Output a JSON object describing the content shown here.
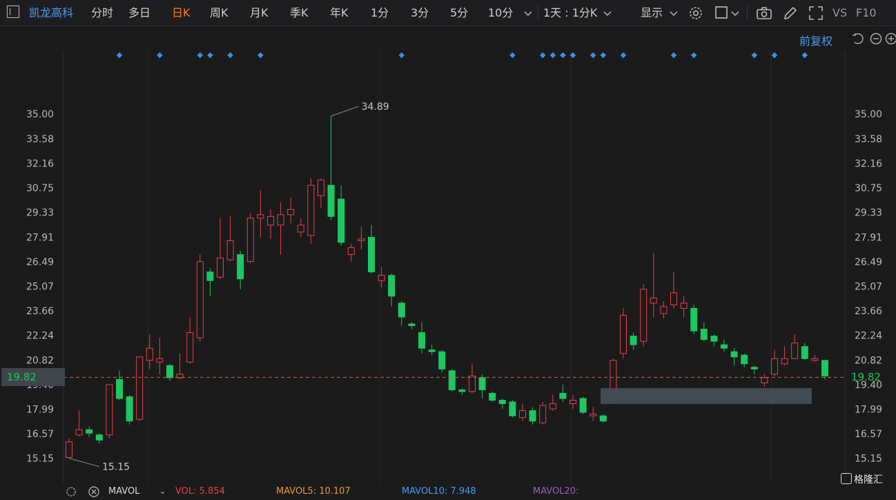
{
  "toolbar": {
    "stock_name": "凯龙高科",
    "periods": [
      "分时",
      "多日",
      "日K",
      "周K",
      "月K",
      "季K",
      "年K",
      "1分",
      "3分",
      "5分",
      "10分"
    ],
    "active_period": "日K",
    "interval": "1天 : 1分K",
    "display": "显示",
    "vs": "VS",
    "f10": "F10"
  },
  "subbar": {
    "adjust": "前复权"
  },
  "price_marker": {
    "current": "19.82",
    "hidden_tick": "19.40"
  },
  "chart_data": {
    "type": "candlestick",
    "y_ticks": [
      35.0,
      33.58,
      32.16,
      30.75,
      29.33,
      27.91,
      26.49,
      25.07,
      23.66,
      22.24,
      20.82,
      19.4,
      17.99,
      16.57,
      15.15
    ],
    "ylim": [
      14.1,
      37.2
    ],
    "high_label": "34.89",
    "low_label": "15.15",
    "current_price": 19.82,
    "up_color": "#e8414c",
    "down_color": "#1ec761",
    "marker_color": "#3f8ff0",
    "candles": [
      {
        "o": 15.2,
        "c": 16.1,
        "h": 16.3,
        "l": 15.15
      },
      {
        "o": 16.5,
        "c": 16.8,
        "h": 17.9,
        "l": 16.4
      },
      {
        "o": 16.8,
        "c": 16.6,
        "h": 17.0,
        "l": 16.4
      },
      {
        "o": 16.5,
        "c": 16.2,
        "h": 16.6,
        "l": 16.0
      },
      {
        "o": 16.5,
        "c": 19.4,
        "h": 19.4,
        "l": 16.3
      },
      {
        "o": 19.7,
        "c": 18.6,
        "h": 20.2,
        "l": 18.5
      },
      {
        "o": 18.7,
        "c": 17.3,
        "h": 18.8,
        "l": 17.1
      },
      {
        "o": 17.4,
        "c": 21.0,
        "h": 21.0,
        "l": 17.3
      },
      {
        "o": 20.8,
        "c": 21.5,
        "h": 22.3,
        "l": 20.3
      },
      {
        "o": 20.7,
        "c": 20.9,
        "h": 22.1,
        "l": 20.0
      },
      {
        "o": 20.5,
        "c": 19.8,
        "h": 20.6,
        "l": 19.6
      },
      {
        "o": 19.8,
        "c": 20.0,
        "h": 21.2,
        "l": 19.7
      },
      {
        "o": 20.7,
        "c": 22.4,
        "h": 23.3,
        "l": 20.6
      },
      {
        "o": 22.1,
        "c": 26.5,
        "h": 26.9,
        "l": 21.9
      },
      {
        "o": 25.9,
        "c": 25.4,
        "h": 26.1,
        "l": 24.5
      },
      {
        "o": 25.6,
        "c": 26.7,
        "h": 29.0,
        "l": 25.5
      },
      {
        "o": 26.6,
        "c": 27.7,
        "h": 29.1,
        "l": 26.5
      },
      {
        "o": 26.9,
        "c": 25.5,
        "h": 27.1,
        "l": 24.9
      },
      {
        "o": 26.5,
        "c": 29.0,
        "h": 29.3,
        "l": 26.4
      },
      {
        "o": 29.0,
        "c": 29.2,
        "h": 30.6,
        "l": 27.9
      },
      {
        "o": 28.6,
        "c": 29.1,
        "h": 29.5,
        "l": 27.8
      },
      {
        "o": 28.6,
        "c": 29.2,
        "h": 29.9,
        "l": 26.9
      },
      {
        "o": 29.2,
        "c": 29.5,
        "h": 30.2,
        "l": 28.7
      },
      {
        "o": 28.2,
        "c": 28.6,
        "h": 29.0,
        "l": 27.9
      },
      {
        "o": 28.0,
        "c": 30.9,
        "h": 31.3,
        "l": 27.5
      },
      {
        "o": 30.3,
        "c": 31.2,
        "h": 31.3,
        "l": 29.6
      },
      {
        "o": 30.9,
        "c": 29.1,
        "h": 34.89,
        "l": 28.9
      },
      {
        "o": 30.1,
        "c": 27.6,
        "h": 30.9,
        "l": 27.4
      },
      {
        "o": 26.9,
        "c": 27.3,
        "h": 27.5,
        "l": 26.5
      },
      {
        "o": 27.7,
        "c": 27.8,
        "h": 28.5,
        "l": 27.2
      },
      {
        "o": 27.9,
        "c": 25.9,
        "h": 28.6,
        "l": 25.8
      },
      {
        "o": 25.4,
        "c": 25.7,
        "h": 26.2,
        "l": 25.0
      },
      {
        "o": 25.7,
        "c": 24.5,
        "h": 25.8,
        "l": 23.9
      },
      {
        "o": 24.1,
        "c": 23.3,
        "h": 24.2,
        "l": 22.8
      },
      {
        "o": 22.9,
        "c": 22.8,
        "h": 23.0,
        "l": 22.6
      },
      {
        "o": 22.4,
        "c": 21.5,
        "h": 23.0,
        "l": 21.2
      },
      {
        "o": 21.4,
        "c": 21.3,
        "h": 21.7,
        "l": 21.1
      },
      {
        "o": 21.3,
        "c": 20.3,
        "h": 21.4,
        "l": 20.1
      },
      {
        "o": 20.2,
        "c": 19.1,
        "h": 20.3,
        "l": 19.0
      },
      {
        "o": 19.1,
        "c": 19.0,
        "h": 19.2,
        "l": 18.8
      },
      {
        "o": 19.0,
        "c": 19.9,
        "h": 20.6,
        "l": 18.9
      },
      {
        "o": 19.8,
        "c": 19.1,
        "h": 20.0,
        "l": 18.6
      },
      {
        "o": 18.9,
        "c": 18.5,
        "h": 19.0,
        "l": 18.4
      },
      {
        "o": 18.5,
        "c": 18.3,
        "h": 18.6,
        "l": 18.0
      },
      {
        "o": 18.4,
        "c": 17.6,
        "h": 18.5,
        "l": 17.5
      },
      {
        "o": 17.5,
        "c": 17.9,
        "h": 18.3,
        "l": 17.3
      },
      {
        "o": 17.9,
        "c": 17.3,
        "h": 18.1,
        "l": 17.1
      },
      {
        "o": 17.2,
        "c": 18.2,
        "h": 18.4,
        "l": 17.1
      },
      {
        "o": 18.0,
        "c": 18.3,
        "h": 18.8,
        "l": 17.9
      },
      {
        "o": 18.9,
        "c": 18.6,
        "h": 19.4,
        "l": 18.4
      },
      {
        "o": 18.3,
        "c": 18.5,
        "h": 18.8,
        "l": 18.0
      },
      {
        "o": 18.6,
        "c": 17.8,
        "h": 18.7,
        "l": 17.7
      },
      {
        "o": 17.6,
        "c": 17.7,
        "h": 18.1,
        "l": 17.3
      },
      {
        "o": 17.6,
        "c": 17.3,
        "h": 17.7,
        "l": 17.2
      },
      {
        "o": 18.6,
        "c": 20.8,
        "h": 20.9,
        "l": 18.5
      },
      {
        "o": 21.2,
        "c": 23.4,
        "h": 23.8,
        "l": 20.9
      },
      {
        "o": 22.2,
        "c": 21.7,
        "h": 22.4,
        "l": 21.4
      },
      {
        "o": 21.9,
        "c": 24.9,
        "h": 25.2,
        "l": 21.6
      },
      {
        "o": 24.1,
        "c": 24.4,
        "h": 27.0,
        "l": 23.3
      },
      {
        "o": 23.5,
        "c": 23.9,
        "h": 24.2,
        "l": 23.2
      },
      {
        "o": 24.0,
        "c": 24.7,
        "h": 25.9,
        "l": 23.8
      },
      {
        "o": 23.8,
        "c": 24.1,
        "h": 24.5,
        "l": 23.3
      },
      {
        "o": 23.8,
        "c": 22.5,
        "h": 24.0,
        "l": 22.3
      },
      {
        "o": 22.6,
        "c": 22.0,
        "h": 23.0,
        "l": 21.9
      },
      {
        "o": 22.2,
        "c": 21.9,
        "h": 22.3,
        "l": 21.6
      },
      {
        "o": 21.7,
        "c": 21.5,
        "h": 22.0,
        "l": 21.3
      },
      {
        "o": 21.3,
        "c": 21.0,
        "h": 21.5,
        "l": 20.5
      },
      {
        "o": 21.1,
        "c": 20.6,
        "h": 21.2,
        "l": 20.4
      },
      {
        "o": 20.4,
        "c": 20.3,
        "h": 20.5,
        "l": 20.0
      },
      {
        "o": 19.5,
        "c": 19.8,
        "h": 20.0,
        "l": 19.3
      },
      {
        "o": 20.0,
        "c": 20.9,
        "h": 21.4,
        "l": 19.9
      },
      {
        "o": 20.6,
        "c": 20.9,
        "h": 21.6,
        "l": 20.5
      },
      {
        "o": 20.9,
        "c": 21.8,
        "h": 22.3,
        "l": 20.9
      },
      {
        "o": 21.6,
        "c": 20.9,
        "h": 21.8,
        "l": 20.8
      },
      {
        "o": 20.8,
        "c": 20.9,
        "h": 21.1,
        "l": 20.7
      },
      {
        "o": 20.8,
        "c": 19.9,
        "h": 20.8,
        "l": 19.7
      }
    ],
    "marker_candles": [
      5,
      9,
      13,
      14,
      16,
      19,
      33,
      44,
      47,
      48,
      49,
      50,
      52,
      53,
      55,
      60,
      62,
      68,
      70,
      73
    ]
  },
  "bottom": {
    "mavol": "MAVOL",
    "vol": "VOL: 5.854",
    "mavol5": "MAVOL5: 10.107",
    "mavol10": "MAVOL10: 7.948",
    "mavol20": "MAVOL20: "
  },
  "logo": "格隆汇",
  "colors": {
    "accent": "#ff7a1a",
    "link": "#4d9cf0",
    "up": "#e8414c",
    "down": "#1ec761"
  }
}
